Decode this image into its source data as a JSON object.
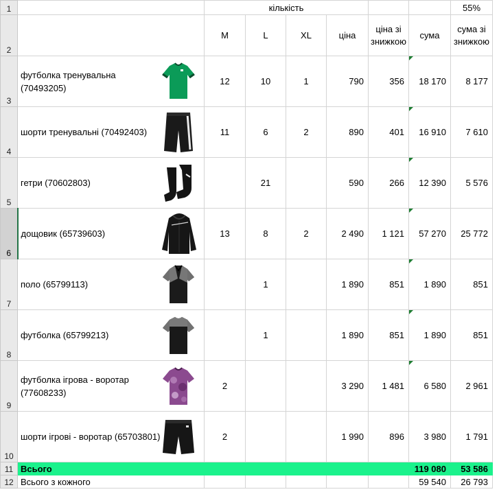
{
  "row_numbers": [
    "1",
    "2",
    "3",
    "4",
    "5",
    "6",
    "7",
    "8",
    "9",
    "10",
    "11",
    "12"
  ],
  "header_top": {
    "qty_label": "кількість",
    "discount": "55%"
  },
  "headers": {
    "m": "M",
    "l": "L",
    "xl": "XL",
    "price": "ціна",
    "disc_price": "ціна зі знижкою",
    "sum": "сума",
    "disc_sum": "сума зі знижкою"
  },
  "products": [
    {
      "name": "футболка тренувальна (70493205)",
      "m": "12",
      "l": "10",
      "xl": "1",
      "price": "790",
      "disc_price": "356",
      "sum": "18 170",
      "disc_sum": "8 177",
      "image": "green-training-tshirt-image"
    },
    {
      "name": "шорти тренувальні (70492403)",
      "m": "11",
      "l": "6",
      "xl": "2",
      "price": "890",
      "disc_price": "401",
      "sum": "16 910",
      "disc_sum": "7 610",
      "image": "black-training-shorts-image"
    },
    {
      "name": "гетри (70602803)",
      "m": "",
      "l": "21",
      "xl": "",
      "price": "590",
      "disc_price": "266",
      "sum": "12 390",
      "disc_sum": "5 576",
      "image": "black-socks-image"
    },
    {
      "name": "дощовик (65739603)",
      "m": "13",
      "l": "8",
      "xl": "2",
      "price": "2 490",
      "disc_price": "1 121",
      "sum": "57 270",
      "disc_sum": "25 772",
      "image": "black-rain-jacket-image"
    },
    {
      "name": "поло (65799113)",
      "m": "",
      "l": "1",
      "xl": "",
      "price": "1 890",
      "disc_price": "851",
      "sum": "1 890",
      "disc_sum": "851",
      "image": "grey-black-polo-image"
    },
    {
      "name": "футболка (65799213)",
      "m": "",
      "l": "1",
      "xl": "",
      "price": "1 890",
      "disc_price": "851",
      "sum": "1 890",
      "disc_sum": "851",
      "image": "grey-black-tshirt-image"
    },
    {
      "name": "футболка ігрова - воротар (77608233)",
      "m": "2",
      "l": "",
      "xl": "",
      "price": "3 290",
      "disc_price": "1 481",
      "sum": "6 580",
      "disc_sum": "2 961",
      "image": "purple-goalkeeper-jersey-image"
    },
    {
      "name": "шорти ігрові - воротар (65703801)",
      "m": "2",
      "l": "",
      "xl": "",
      "price": "1 990",
      "disc_price": "896",
      "sum": "3 980",
      "disc_sum": "1 791",
      "image": "black-goalkeeper-shorts-image"
    }
  ],
  "total": {
    "label": "Всього",
    "sum": "119 080",
    "disc_sum": "53 586"
  },
  "each_total": {
    "label": "Всього з кожного",
    "sum": "59 540",
    "disc_sum": "26 793"
  },
  "colors": {
    "total_row": "#1bf28c",
    "comment_marker": "#1e7d32",
    "selected_row_header": "#d2d2d2"
  }
}
